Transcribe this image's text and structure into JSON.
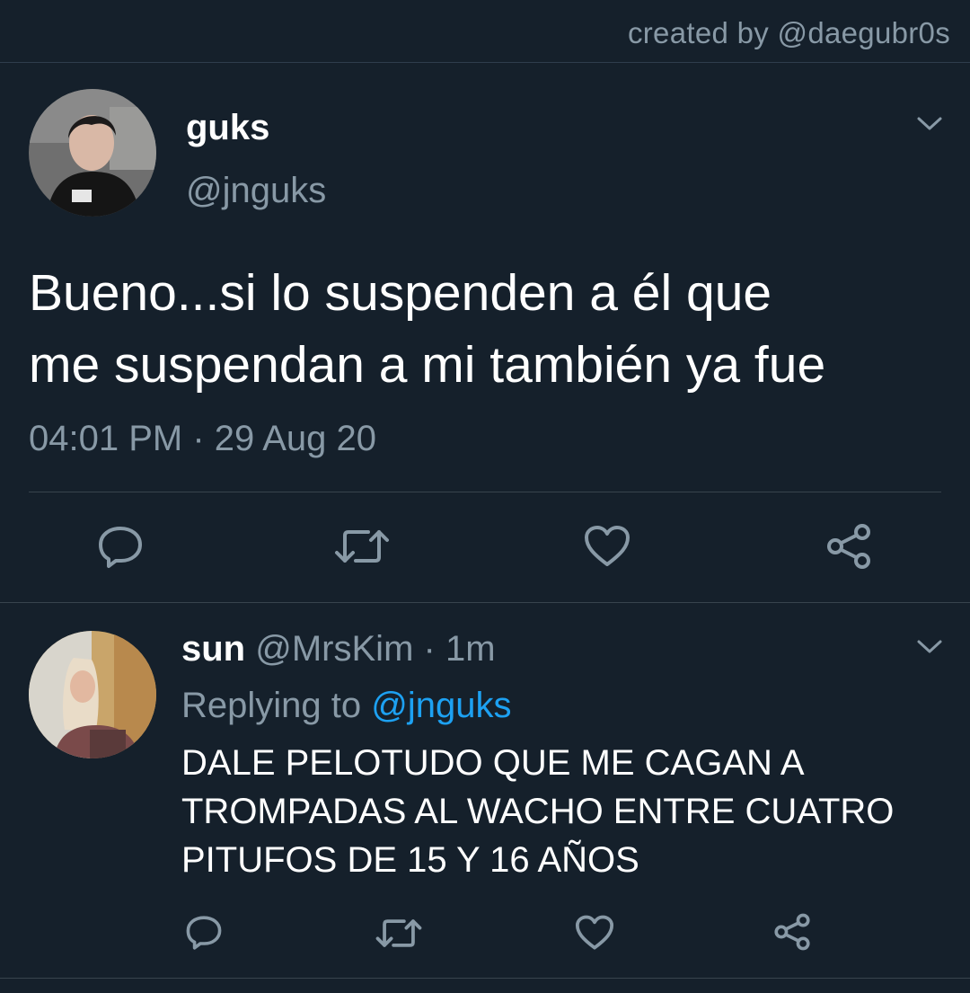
{
  "credit": "created by @daegubr0s",
  "tweet": {
    "display_name": "guks",
    "handle": "@jnguks",
    "text_line1": "Bueno...si lo suspenden a él que",
    "text_line2": "me suspendan a mi también ya fue",
    "time": "04:01 PM",
    "separator": "·",
    "date": "29 Aug 20",
    "avatar_icon": "user-photo-avatar",
    "actions": [
      "reply-icon",
      "retweet-icon",
      "like-icon",
      "share-icon"
    ]
  },
  "reply": {
    "display_name": "sun",
    "handle": "@MrsKim",
    "separator": "·",
    "age": "1m",
    "replying_prefix": "Replying to",
    "replying_to": "@jnguks",
    "text_line1": "DALE PELOTUDO QUE ME CAGAN A",
    "text_line2": "TROMPADAS AL WACHO ENTRE CUATRO",
    "text_line3": "PITUFOS DE 15 Y 16 AÑOS",
    "avatar_icon": "user-photo-avatar",
    "actions": [
      "reply-icon",
      "retweet-icon",
      "like-icon",
      "share-icon"
    ]
  },
  "colors": {
    "background": "#15202b",
    "text_primary": "#ffffff",
    "text_secondary": "#8899a6",
    "accent": "#1da1f2",
    "divider": "#38444d"
  }
}
